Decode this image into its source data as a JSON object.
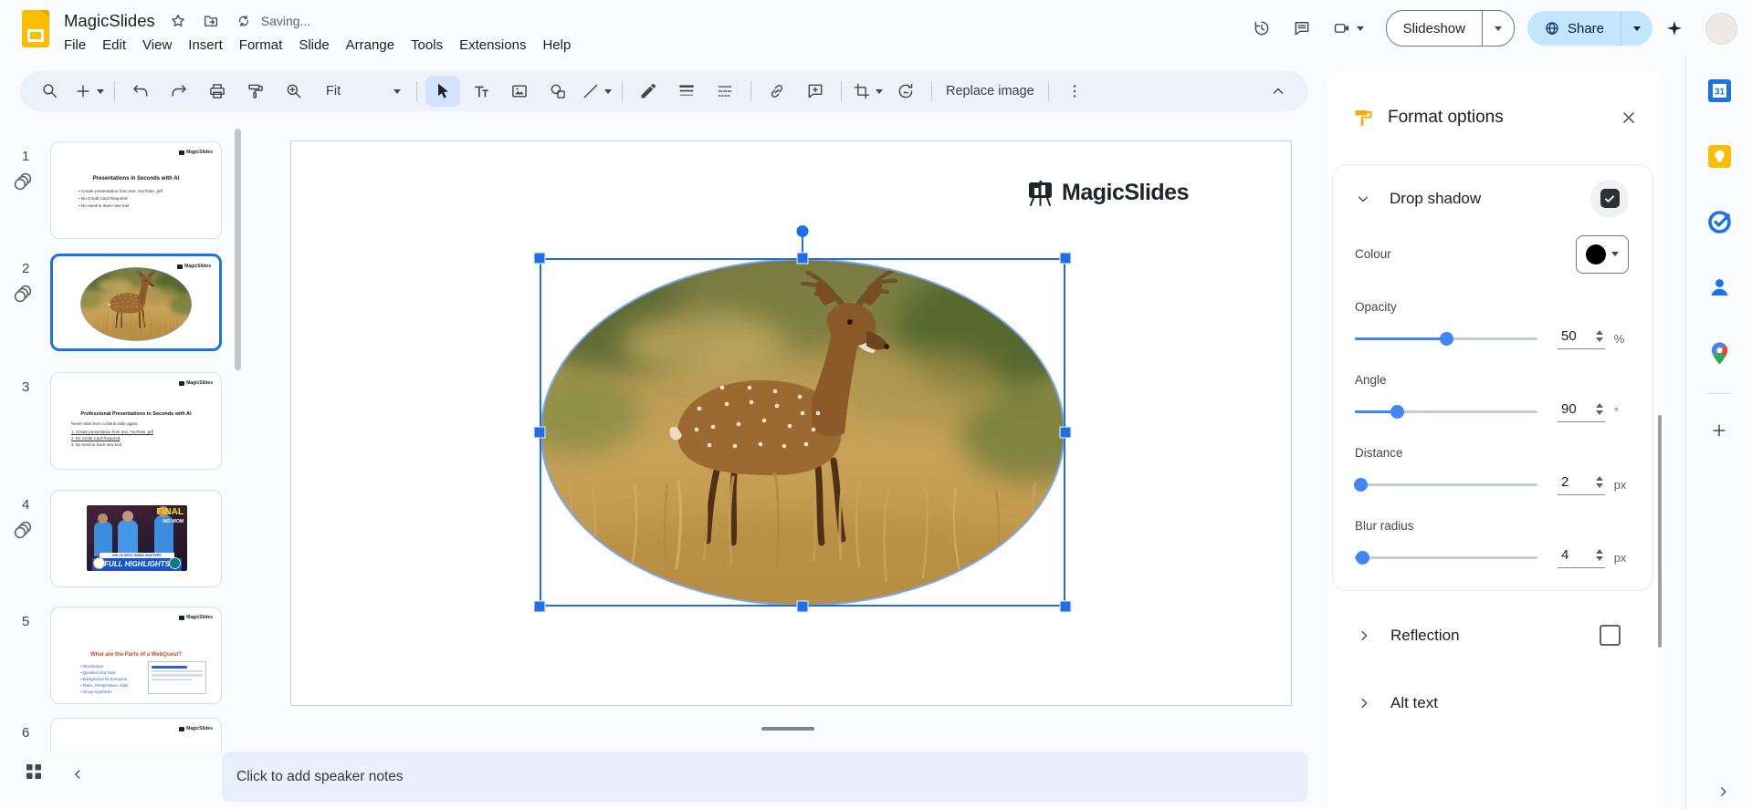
{
  "colors": {
    "accent": "#1a73e8",
    "toolbar_bg": "#edf2fa",
    "share_button_bg": "#c2e7ff",
    "selection": "#1f6ee8",
    "shadow_colour_swatch": "#000000"
  },
  "header": {
    "title": "MagicSlides",
    "saving_status": "Saving...",
    "menus": [
      "File",
      "Edit",
      "View",
      "Insert",
      "Format",
      "Slide",
      "Arrange",
      "Tools",
      "Extensions",
      "Help"
    ],
    "slideshow_label": "Slideshow",
    "share_label": "Share"
  },
  "toolbar": {
    "fit_label": "Fit",
    "replace_image_label": "Replace image"
  },
  "filmstrip": {
    "slides": [
      {
        "number": "1",
        "logo": "MagicSlides",
        "title": "Presentations in Seconds with AI",
        "bullets": [
          "Create presentation from text, YouTube, pdf",
          "No Credit Card Required",
          "No need to learn new tool"
        ]
      },
      {
        "number": "2",
        "logo": "MagicSlides"
      },
      {
        "number": "3",
        "logo": "MagicSlides",
        "title": "Professional Presentations in Seconds with AI",
        "subtitle": "Never start from a blank slide again.",
        "items": [
          "1. Create presentation from text, YouTube, pdf",
          "2. No Credit Card Required",
          "3. No need to learn new tool"
        ]
      },
      {
        "number": "4",
        "overlay_title": "FINAL",
        "overlay_subtitle": "IND WOM",
        "strip_text": "IND VS WEST INDIES MASTERS",
        "band_text": "FULL HIGHLIGHTS"
      },
      {
        "number": "5",
        "logo": "MagicSlides",
        "title": "What are the Parts of a WebQuest?",
        "bullets": [
          "Introduction",
          "Question and Task",
          "Background for Everyone",
          "Roles, Perspectives, Jobs",
          "Group Synthesis"
        ]
      },
      {
        "number": "6",
        "logo": "MagicSlides"
      }
    ]
  },
  "canvas": {
    "logo_text": "MagicSlides"
  },
  "notes_placeholder": "Click to add speaker notes",
  "format_panel": {
    "title": "Format options",
    "drop_shadow": {
      "label": "Drop shadow",
      "checked": true,
      "colour_label": "Colour",
      "controls": [
        {
          "label": "Opacity",
          "value": "50",
          "unit": "%",
          "percent": 50
        },
        {
          "label": "Angle",
          "value": "90",
          "unit": "°",
          "percent": 23
        },
        {
          "label": "Distance",
          "value": "2",
          "unit": "px",
          "percent": 3
        },
        {
          "label": "Blur radius",
          "value": "4",
          "unit": "px",
          "percent": 4
        }
      ]
    },
    "reflection_label": "Reflection",
    "alt_text_label": "Alt text"
  },
  "icons": [
    "search",
    "add",
    "undo",
    "redo",
    "print",
    "paint-format",
    "zoom-in",
    "select-cursor",
    "text-box",
    "insert-image",
    "insert-shape",
    "insert-line",
    "border-color",
    "border-weight",
    "border-dash",
    "insert-link",
    "add-comment",
    "crop",
    "reset-image",
    "more-options",
    "collapse-toolbar",
    "version-history",
    "open-comments",
    "meet-camera",
    "gemini-sparkle",
    "grid-view",
    "collapse-filmstrip",
    "calendar",
    "keep",
    "tasks",
    "contacts",
    "maps",
    "add-app",
    "expand-side-panel"
  ]
}
